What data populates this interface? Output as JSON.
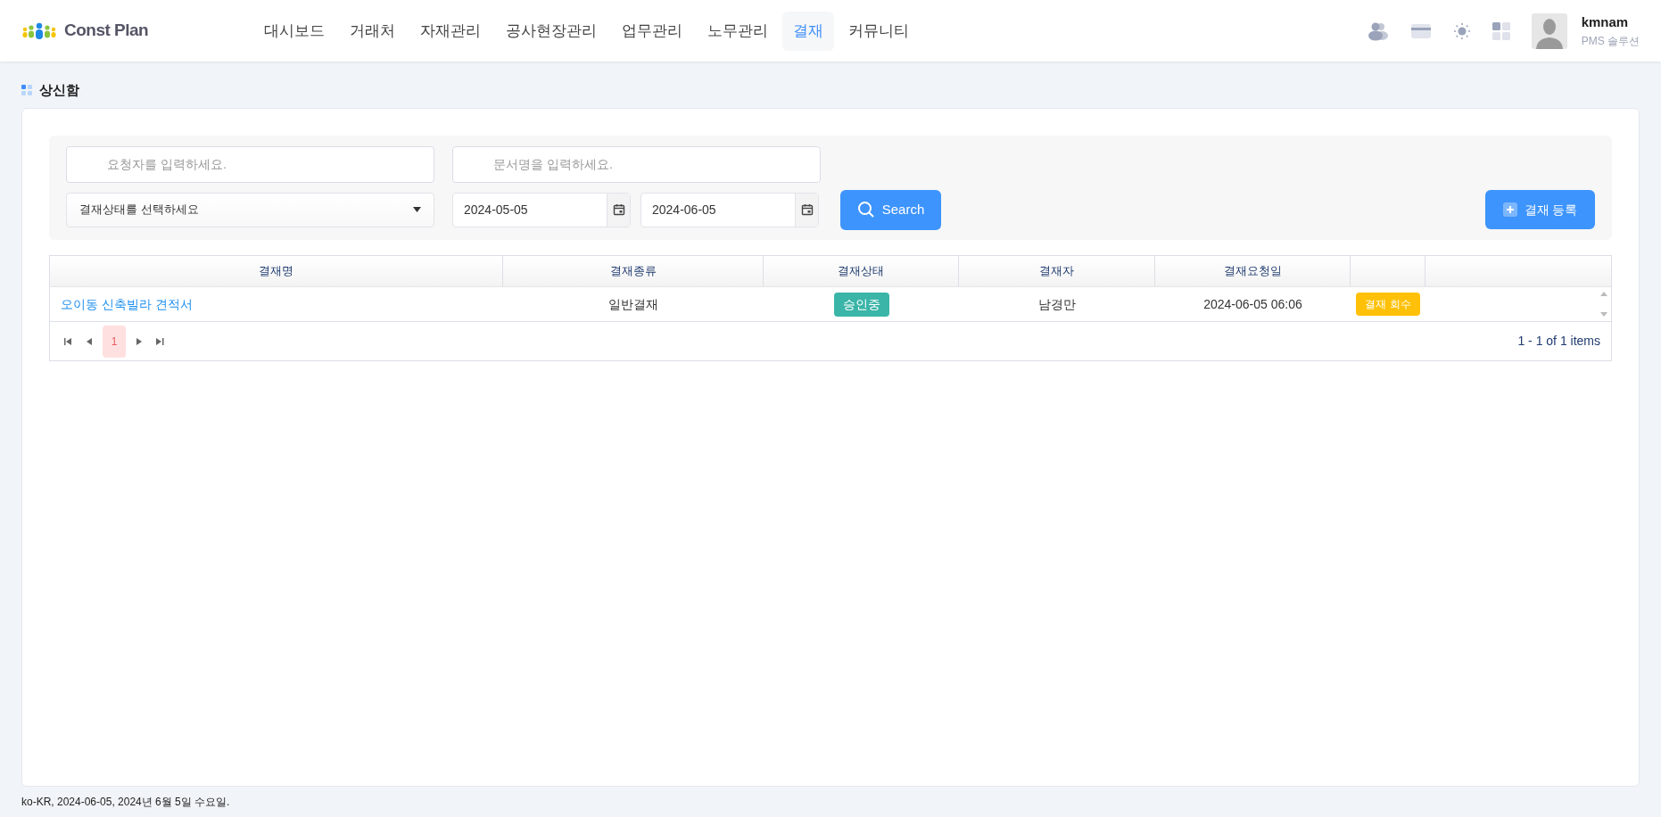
{
  "header": {
    "logo": "Const Plan",
    "nav": [
      {
        "label": "대시보드",
        "selected": false
      },
      {
        "label": "거래처",
        "selected": false
      },
      {
        "label": "자재관리",
        "selected": false
      },
      {
        "label": "공사현장관리",
        "selected": false
      },
      {
        "label": "업무관리",
        "selected": false
      },
      {
        "label": "노무관리",
        "selected": false
      },
      {
        "label": "결재",
        "selected": true
      },
      {
        "label": "커뮤니티",
        "selected": false
      }
    ],
    "user": {
      "name": "kmnam",
      "role": "PMS 솔루션"
    }
  },
  "page_title": "상신함",
  "filters": {
    "requester": {
      "placeholder": "요청자를 입력하세요."
    },
    "document": {
      "placeholder": "문서명을 입력하세요."
    },
    "status_select": {
      "value": "결재상태를 선택하세요"
    },
    "date_from": {
      "value": "2024-05-05"
    },
    "date_to": {
      "value": "2024-06-05"
    },
    "search_button": "Search",
    "register_button": "결재 등록"
  },
  "table": {
    "columns": [
      "결재명",
      "결재종류",
      "결재상태",
      "결재자",
      "결재요청일"
    ],
    "rows": [
      {
        "title": "오이동 신축빌라 견적서",
        "type": "일반결재",
        "status": "승인중",
        "approver": "남경만",
        "requested": "2024-06-05 06:06",
        "action": "결재 회수"
      }
    ],
    "pager": {
      "pages": [
        {
          "label": "1",
          "selected": true
        }
      ],
      "summary": "1 - 1 of 1 items"
    }
  },
  "footer": "ko-KR, 2024-06-05, 2024년 6월 5일 수요일."
}
